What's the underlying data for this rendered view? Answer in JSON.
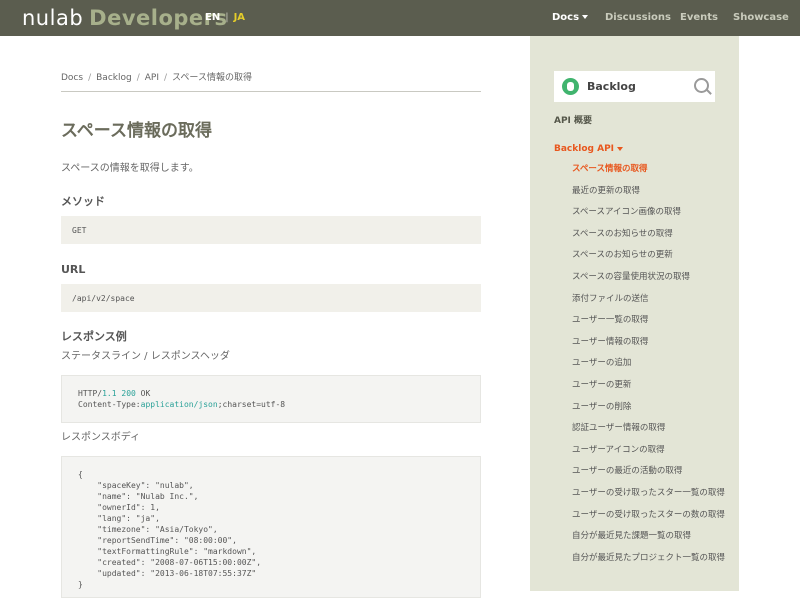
{
  "header": {
    "logo_main": "nulab",
    "logo_sub": "Developers",
    "lang_en": "EN",
    "lang_sep": "|",
    "lang_ja": "JA",
    "nav": [
      "Docs",
      "Discussions",
      "Events",
      "Showcase"
    ]
  },
  "breadcrumb": [
    "Docs",
    "Backlog",
    "API",
    "スペース情報の取得"
  ],
  "main": {
    "title": "スペース情報の取得",
    "description": "スペースの情報を取得します。",
    "method_heading": "メソッド",
    "method": "GET",
    "url_heading": "URL",
    "url": "/api/v2/space",
    "response_heading": "レスポンス例",
    "status_heading": "ステータスライン / レスポンスヘッダ",
    "status_line": {
      "proto": "HTTP/",
      "version": "1.1",
      "code": "200",
      "text": "OK"
    },
    "content_type": {
      "label": "Content-Type:",
      "value": "application/json",
      "rest": ";charset=utf-8"
    },
    "body_heading": "レスポンスボディ",
    "body_lines": [
      "{",
      "    \"spaceKey\": \"nulab\",",
      "    \"name\": \"Nulab Inc.\",",
      "    \"ownerId\": 1,",
      "    \"lang\": \"ja\",",
      "    \"timezone\": \"Asia/Tokyo\",",
      "    \"reportSendTime\": \"08:00:00\",",
      "    \"textFormattingRule\": \"markdown\",",
      "    \"created\": \"2008-07-06T15:00:00Z\",",
      "    \"updated\": \"2013-06-18T07:55:37Z\"",
      "}"
    ]
  },
  "sidebar": {
    "product": "Backlog",
    "overview": "API 概要",
    "api_label": "Backlog API",
    "items": [
      "スペース情報の取得",
      "最近の更新の取得",
      "スペースアイコン画像の取得",
      "スペースのお知らせの取得",
      "スペースのお知らせの更新",
      "スペースの容量使用状況の取得",
      "添付ファイルの送信",
      "ユーザー一覧の取得",
      "ユーザー情報の取得",
      "ユーザーの追加",
      "ユーザーの更新",
      "ユーザーの削除",
      "認証ユーザー情報の取得",
      "ユーザーアイコンの取得",
      "ユーザーの最近の活動の取得",
      "ユーザーの受け取ったスター一覧の取得",
      "ユーザーの受け取ったスターの数の取得",
      "自分が最近見た課題一覧の取得",
      "自分が最近見たプロジェクト一覧の取得"
    ]
  },
  "colors": {
    "topbar": "#5b5d4f",
    "accent": "#e8571e",
    "sidebar_bg": "#e3e5d6",
    "lang_active": "#e5cd2a"
  }
}
